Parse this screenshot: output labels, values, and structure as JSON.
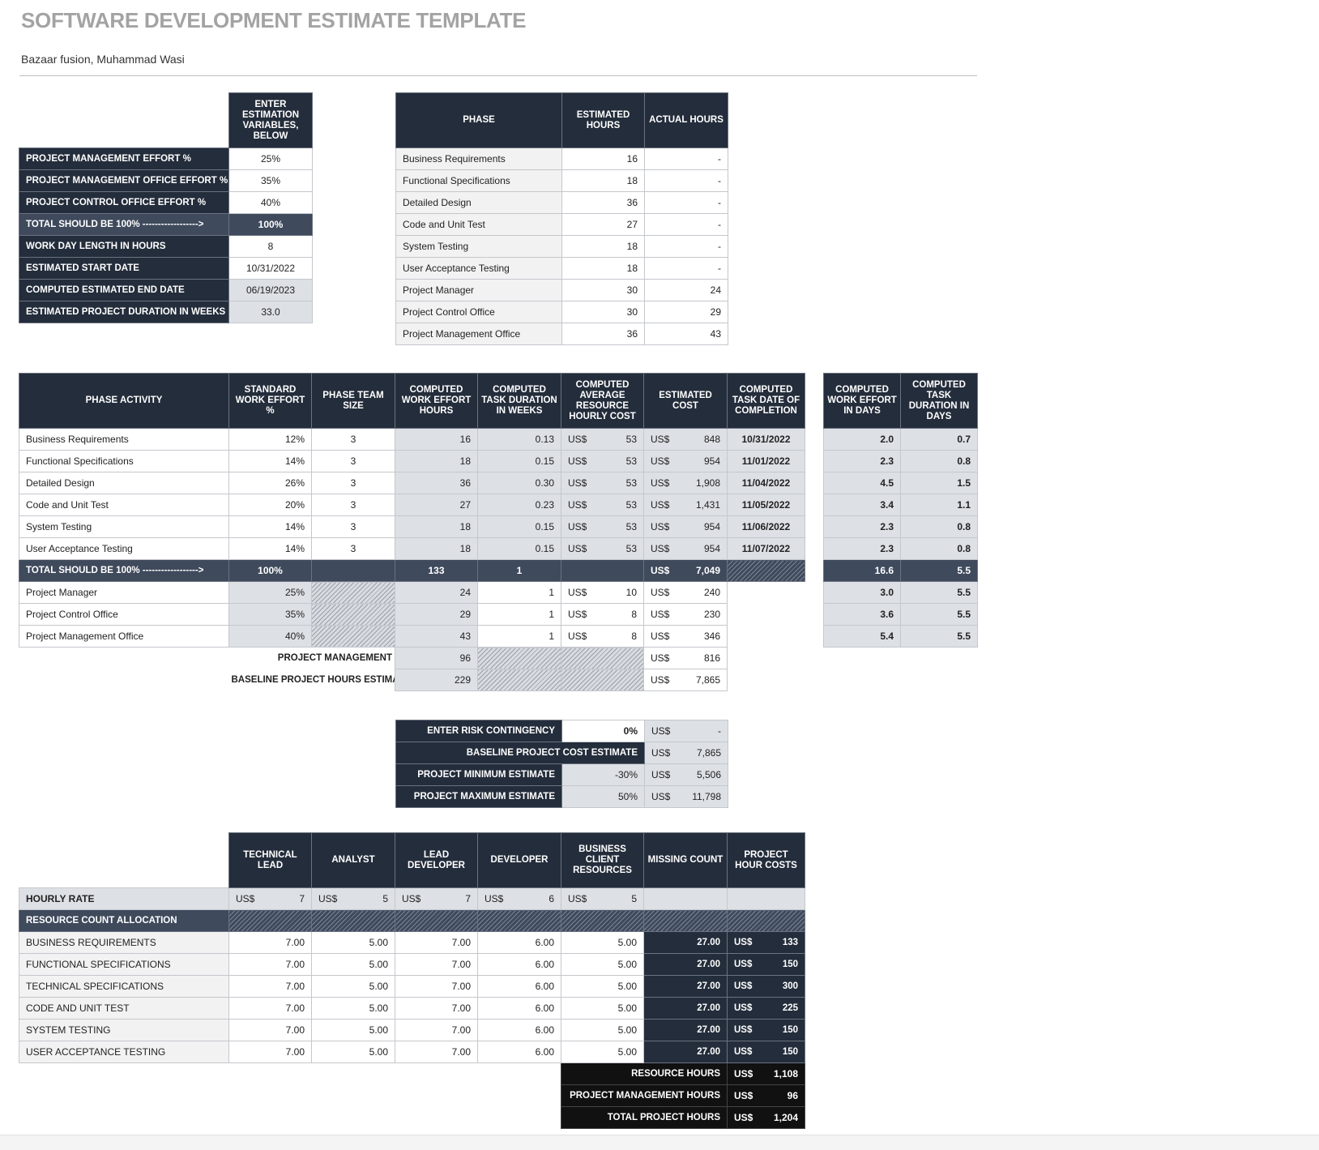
{
  "title": "SOFTWARE DEVELOPMENT ESTIMATE TEMPLATE",
  "subtitle": "Bazaar fusion, Muhammad Wasi",
  "variables": {
    "header": "ENTER ESTIMATION VARIABLES, BELOW",
    "rows": [
      {
        "label": "PROJECT MANAGEMENT EFFORT %",
        "value": "25%"
      },
      {
        "label": "PROJECT MANAGEMENT OFFICE EFFORT %",
        "value": "35%"
      },
      {
        "label": "PROJECT CONTROL OFFICE EFFORT %",
        "value": "40%"
      },
      {
        "label": "TOTAL SHOULD BE 100% ------------------>",
        "value": "100%"
      },
      {
        "label": "WORK DAY LENGTH IN HOURS",
        "value": "8"
      },
      {
        "label": "ESTIMATED START DATE",
        "value": "10/31/2022"
      },
      {
        "label": "COMPUTED ESTIMATED END DATE",
        "value": "06/19/2023"
      },
      {
        "label": "ESTIMATED PROJECT DURATION IN WEEKS",
        "value": "33.0"
      }
    ]
  },
  "phase_hours": {
    "headers": {
      "phase": "PHASE",
      "estimated": "ESTIMATED HOURS",
      "actual": "ACTUAL HOURS"
    },
    "rows": [
      {
        "phase": "Business Requirements",
        "estimated": "16",
        "actual": "-"
      },
      {
        "phase": "Functional Specifications",
        "estimated": "18",
        "actual": "-"
      },
      {
        "phase": "Detailed Design",
        "estimated": "36",
        "actual": "-"
      },
      {
        "phase": "Code and Unit Test",
        "estimated": "27",
        "actual": "-"
      },
      {
        "phase": "System Testing",
        "estimated": "18",
        "actual": "-"
      },
      {
        "phase": "User Acceptance Testing",
        "estimated": "18",
        "actual": "-"
      },
      {
        "phase": "Project Manager",
        "estimated": "30",
        "actual": "24"
      },
      {
        "phase": "Project Control Office",
        "estimated": "30",
        "actual": "29"
      },
      {
        "phase": "Project Management Office",
        "estimated": "36",
        "actual": "43"
      }
    ]
  },
  "activity": {
    "currency": "US$",
    "headers": {
      "activity": "PHASE ACTIVITY",
      "std_effort": "STANDARD WORK EFFORT %",
      "team_size": "PHASE TEAM SIZE",
      "work_hours": "COMPUTED WORK EFFORT HOURS",
      "duration_weeks": "COMPUTED TASK DURATION IN WEEKS",
      "avg_cost": "COMPUTED AVERAGE RESOURCE HOURLY COST",
      "est_cost": "ESTIMATED COST",
      "completion": "COMPUTED TASK DATE OF COMPLETION"
    },
    "rows": [
      {
        "activity": "Business Requirements",
        "std": "12%",
        "team": "3",
        "hours": "16",
        "weeks": "0.13",
        "rate": "53",
        "cost": "848",
        "date": "10/31/2022"
      },
      {
        "activity": "Functional Specifications",
        "std": "14%",
        "team": "3",
        "hours": "18",
        "weeks": "0.15",
        "rate": "53",
        "cost": "954",
        "date": "11/01/2022"
      },
      {
        "activity": "Detailed Design",
        "std": "26%",
        "team": "3",
        "hours": "36",
        "weeks": "0.30",
        "rate": "53",
        "cost": "1,908",
        "date": "11/04/2022"
      },
      {
        "activity": "Code and Unit Test",
        "std": "20%",
        "team": "3",
        "hours": "27",
        "weeks": "0.23",
        "rate": "53",
        "cost": "1,431",
        "date": "11/05/2022"
      },
      {
        "activity": "System Testing",
        "std": "14%",
        "team": "3",
        "hours": "18",
        "weeks": "0.15",
        "rate": "53",
        "cost": "954",
        "date": "11/06/2022"
      },
      {
        "activity": "User Acceptance Testing",
        "std": "14%",
        "team": "3",
        "hours": "18",
        "weeks": "0.15",
        "rate": "53",
        "cost": "954",
        "date": "11/07/2022"
      }
    ],
    "total": {
      "label": "TOTAL SHOULD BE 100% ------------------>",
      "std": "100%",
      "hours": "133",
      "weeks": "1",
      "cost": "7,049"
    },
    "pm_rows": [
      {
        "activity": "Project Manager",
        "std": "25%",
        "hours": "24",
        "weeks": "1",
        "rate": "10",
        "cost": "240"
      },
      {
        "activity": "Project Control Office",
        "std": "35%",
        "hours": "29",
        "weeks": "1",
        "rate": "8",
        "cost": "230"
      },
      {
        "activity": "Project Management Office",
        "std": "40%",
        "hours": "43",
        "weeks": "1",
        "rate": "8",
        "cost": "346"
      }
    ],
    "project_management": {
      "label": "PROJECT MANAGEMENT",
      "hours": "96",
      "cost": "816"
    },
    "baseline": {
      "label": "BASELINE PROJECT HOURS ESTIMATE",
      "hours": "229",
      "cost": "7,865"
    }
  },
  "days": {
    "headers": {
      "effort_days": "COMPUTED WORK EFFORT IN DAYS",
      "duration_days": "COMPUTED TASK DURATION IN DAYS"
    },
    "rows": [
      {
        "effort": "2.0",
        "duration": "0.7"
      },
      {
        "effort": "2.3",
        "duration": "0.8"
      },
      {
        "effort": "4.5",
        "duration": "1.5"
      },
      {
        "effort": "3.4",
        "duration": "1.1"
      },
      {
        "effort": "2.3",
        "duration": "0.8"
      },
      {
        "effort": "2.3",
        "duration": "0.8"
      },
      {
        "effort": "16.6",
        "duration": "5.5"
      },
      {
        "effort": "3.0",
        "duration": "5.5"
      },
      {
        "effort": "3.6",
        "duration": "5.5"
      },
      {
        "effort": "5.4",
        "duration": "5.5"
      }
    ]
  },
  "risk": {
    "rows": [
      {
        "label": "ENTER RISK CONTINGENCY",
        "pct": "0%",
        "value": "-"
      },
      {
        "label": "BASELINE PROJECT COST ESTIMATE",
        "pct": "",
        "value": "7,865"
      },
      {
        "label": "PROJECT MINIMUM ESTIMATE",
        "pct": "-30%",
        "value": "5,506"
      },
      {
        "label": "PROJECT MAXIMUM ESTIMATE",
        "pct": "50%",
        "value": "11,798"
      }
    ]
  },
  "resources": {
    "headers": [
      "TECHNICAL LEAD",
      "ANALYST",
      "LEAD DEVELOPER",
      "DEVELOPER",
      "BUSINESS CLIENT RESOURCES",
      "MISSING COUNT",
      "PROJECT HOUR COSTS"
    ],
    "hourly_rate_label": "HOURLY RATE",
    "hourly_rates": [
      "7",
      "5",
      "7",
      "6",
      "5"
    ],
    "allocation_label": "RESOURCE COUNT ALLOCATION",
    "rows": [
      {
        "label": "BUSINESS REQUIREMENTS",
        "vals": [
          "7.00",
          "5.00",
          "7.00",
          "6.00",
          "5.00"
        ],
        "missing": "27.00",
        "cost": "133"
      },
      {
        "label": "FUNCTIONAL SPECIFICATIONS",
        "vals": [
          "7.00",
          "5.00",
          "7.00",
          "6.00",
          "5.00"
        ],
        "missing": "27.00",
        "cost": "150"
      },
      {
        "label": "TECHNICAL SPECIFICATIONS",
        "vals": [
          "7.00",
          "5.00",
          "7.00",
          "6.00",
          "5.00"
        ],
        "missing": "27.00",
        "cost": "300"
      },
      {
        "label": "CODE AND UNIT TEST",
        "vals": [
          "7.00",
          "5.00",
          "7.00",
          "6.00",
          "5.00"
        ],
        "missing": "27.00",
        "cost": "225"
      },
      {
        "label": "SYSTEM TESTING",
        "vals": [
          "7.00",
          "5.00",
          "7.00",
          "6.00",
          "5.00"
        ],
        "missing": "27.00",
        "cost": "150"
      },
      {
        "label": "USER ACCEPTANCE TESTING",
        "vals": [
          "7.00",
          "5.00",
          "7.00",
          "6.00",
          "5.00"
        ],
        "missing": "27.00",
        "cost": "150"
      }
    ],
    "totals": [
      {
        "label": "RESOURCE HOURS",
        "value": "1,108"
      },
      {
        "label": "PROJECT MANAGEMENT HOURS",
        "value": "96"
      },
      {
        "label": "TOTAL PROJECT HOURS",
        "value": "1,204"
      }
    ]
  }
}
